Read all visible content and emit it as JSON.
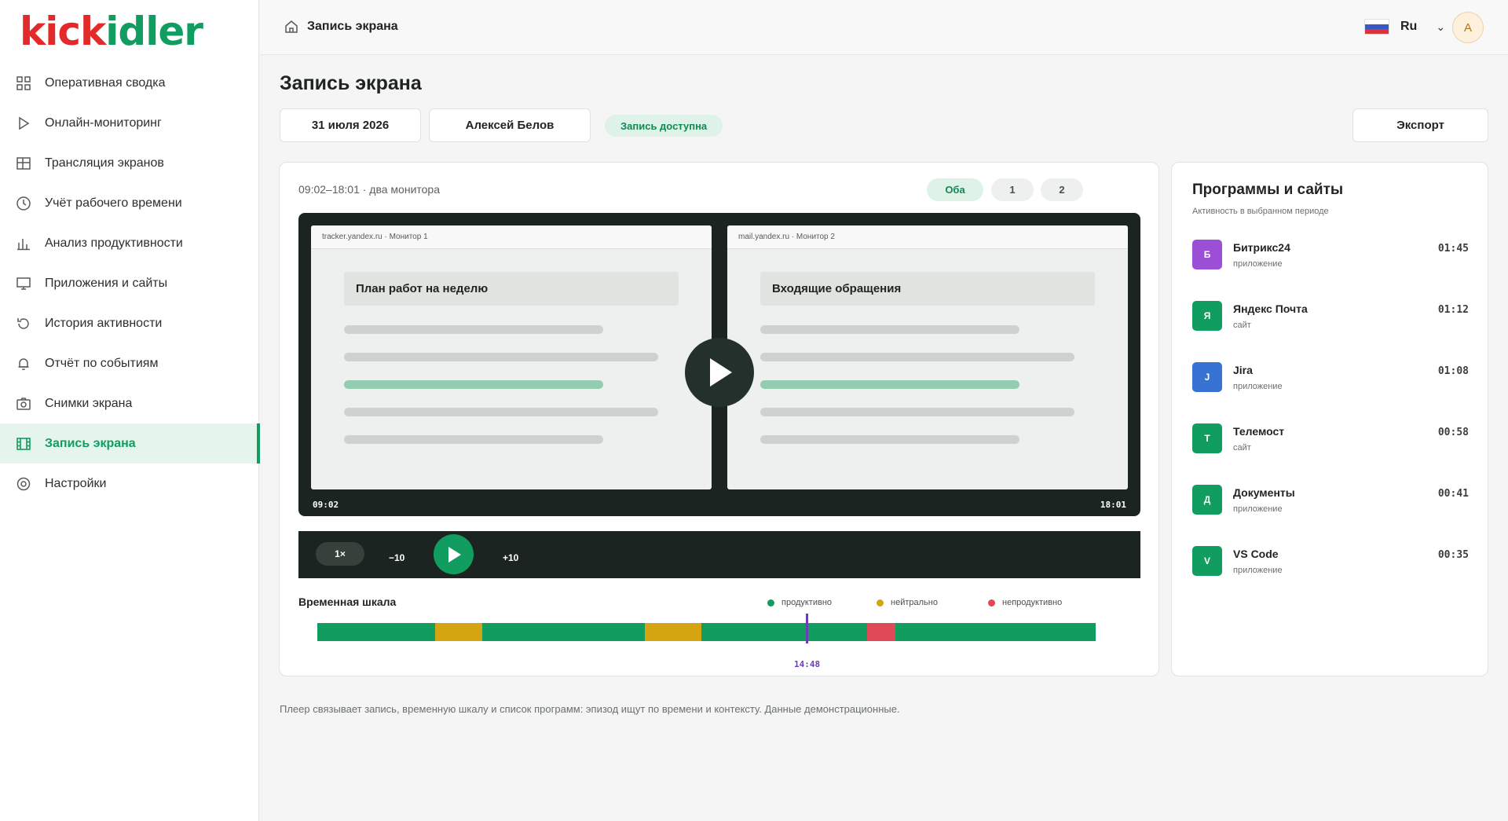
{
  "logo": {
    "red": "kick",
    "green": "idler",
    "accent": "#e32a2a",
    "brand": "#129d60"
  },
  "sidebar": {
    "items": [
      {
        "label": "Оперативная сводка",
        "icon": "grid-icon"
      },
      {
        "label": "Онлайн-мониторинг",
        "icon": "play-outline-icon"
      },
      {
        "label": "Трансляция экранов",
        "icon": "table-icon"
      },
      {
        "label": "Учёт рабочего времени",
        "icon": "clock-icon"
      },
      {
        "label": "Анализ продуктивности",
        "icon": "bar-chart-icon"
      },
      {
        "label": "Приложения и сайты",
        "icon": "monitor-icon"
      },
      {
        "label": "История активности",
        "icon": "history-icon"
      },
      {
        "label": "Отчёт по событиям",
        "icon": "bell-icon"
      },
      {
        "label": "Снимки экрана",
        "icon": "camera-icon"
      },
      {
        "label": "Запись экрана",
        "icon": "film-icon",
        "active": true
      },
      {
        "label": "Настройки",
        "icon": "settings-icon"
      }
    ]
  },
  "topbar": {
    "breadcrumb": "Запись экрана",
    "language": "Ru",
    "avatar": "А"
  },
  "page": {
    "title": "Запись экрана",
    "date": "31 июля 2026",
    "employee": "Алексей Белов",
    "status": "Запись доступна",
    "export_label": "Экспорт"
  },
  "player": {
    "range": "09:02–18:01 · два монитора",
    "monitor_tabs": [
      "Оба",
      "1",
      "2"
    ],
    "active_tab": "Оба",
    "screen1": {
      "bar": "tracker.yandex.ru · Монитор 1",
      "heading": "План работ на неделю"
    },
    "screen2": {
      "bar": "mail.yandex.ru · Монитор 2",
      "heading": "Входящие обращения"
    },
    "time_start": "09:02",
    "time_end": "18:01",
    "speed": "1×",
    "skip_back": "−10",
    "skip_forward": "+10"
  },
  "timeline": {
    "title": "Временная шкала",
    "legend": [
      {
        "label": "продуктивно",
        "color": "#129d60"
      },
      {
        "label": "нейтрально",
        "color": "#d4a511"
      },
      {
        "label": "непродуктивно",
        "color": "#de4a57"
      }
    ],
    "segments": [
      {
        "kind": "productive",
        "fraction": 0.151
      },
      {
        "kind": "neutral",
        "fraction": 0.061
      },
      {
        "kind": "productive",
        "fraction": 0.209
      },
      {
        "kind": "neutral",
        "fraction": 0.073
      },
      {
        "kind": "productive",
        "fraction": 0.213
      },
      {
        "kind": "unproductive",
        "fraction": 0.036
      },
      {
        "kind": "productive",
        "fraction": 0.257
      }
    ],
    "cursor_time": "14:48"
  },
  "apps": {
    "title": "Программы и сайты",
    "subtitle": "Активность в выбранном периоде",
    "items": [
      {
        "initial": "Б",
        "name": "Битрикс24",
        "type": "приложение",
        "time": "01:45",
        "color": "#9a4fd6"
      },
      {
        "initial": "Я",
        "name": "Яндекс Почта",
        "type": "сайт",
        "time": "01:12",
        "color": "#129d60"
      },
      {
        "initial": "J",
        "name": "Jira",
        "type": "приложение",
        "time": "01:08",
        "color": "#3872d2"
      },
      {
        "initial": "Т",
        "name": "Телемост",
        "type": "сайт",
        "time": "00:58",
        "color": "#129d60"
      },
      {
        "initial": "Д",
        "name": "Документы",
        "type": "приложение",
        "time": "00:41",
        "color": "#129d60"
      },
      {
        "initial": "V",
        "name": "VS Code",
        "type": "приложение",
        "time": "00:35",
        "color": "#129d60"
      }
    ]
  },
  "footnote": "Плеер связывает запись, временную шкалу и список программ: эпизод ищут по времени и контексту. Данные демонстрационные."
}
